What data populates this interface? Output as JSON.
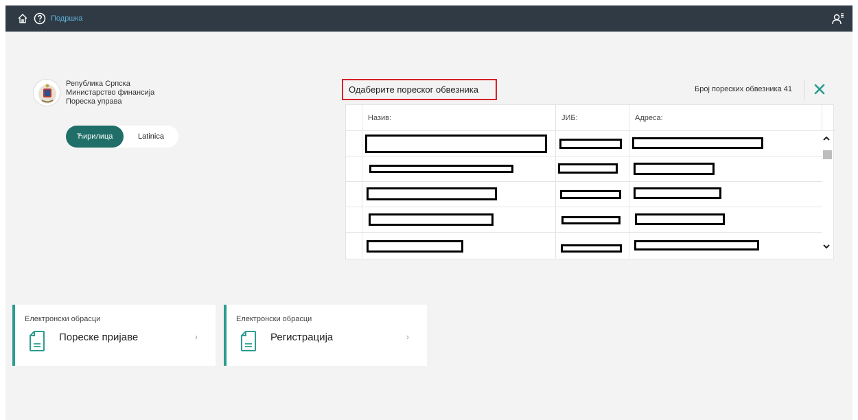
{
  "topbar": {
    "help_label": "Подршка"
  },
  "org": {
    "line1": "Република Српска",
    "line2": "Министарство финансија",
    "line3": "Пореска управа"
  },
  "language": {
    "cyrillic": "Ћирилица",
    "latin": "Latinica",
    "active": "Ћирилица"
  },
  "taxpayer_select": {
    "title": "Одаберите пореског обвезника",
    "count_label": "Број пореских обвезника 41",
    "columns": [
      "Назив:",
      "ЈИБ:",
      "Адреса:"
    ],
    "rows_redacted": 5
  },
  "cards": [
    {
      "category": "Електронски обрасци",
      "title": "Пореске пријаве",
      "chevron": "›"
    },
    {
      "category": "Електронски обрасци",
      "title": "Регистрација",
      "chevron": "›"
    }
  ],
  "colors": {
    "topbar": "#2f3a45",
    "accent": "#1f6e68",
    "card_accent": "#2a9d8f",
    "highlight_red": "#d6222b",
    "help_link": "#5fb0d8",
    "close_x": "#2a9d8f"
  },
  "icons": {
    "home": "home-icon",
    "help": "help-circle-icon",
    "user": "user-menu-icon",
    "close": "close-icon",
    "document": "document-icon"
  }
}
